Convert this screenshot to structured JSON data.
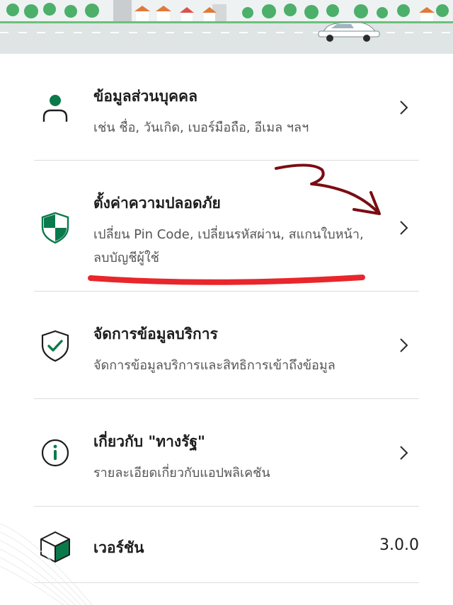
{
  "colors": {
    "brand_green": "#0b7a4b",
    "annotation_red": "#e8262b",
    "annotation_dark": "#7a0d12",
    "divider": "#dcdcdc",
    "banner_bg": "#eef2f2"
  },
  "menu": {
    "items": [
      {
        "icon": "person-icon",
        "title": "ข้อมูลส่วนบุคคล",
        "subtitle": "เช่น ชื่อ, วันเกิด, เบอร์มือถือ, อีเมล ฯลฯ"
      },
      {
        "icon": "shield-icon",
        "title": "ตั้งค่าความปลอดภัย",
        "subtitle": "เปลี่ยน Pin Code, เปลี่ยนรหัสผ่าน, สแกนใบหน้า, ลบบัญชีผู้ใช้"
      },
      {
        "icon": "shield-check-icon",
        "title": "จัดการข้อมูลบริการ",
        "subtitle": "จัดการข้อมูลบริการและสิทธิการเข้าถึงข้อมูล"
      },
      {
        "icon": "info-icon",
        "title": "เกี่ยวกับ \"ทางรัฐ\"",
        "subtitle": "รายละเอียดเกี่ยวกับแอปพลิเคชัน"
      },
      {
        "icon": "cube-icon",
        "title": "เวอร์ชัน",
        "value": "3.0.0"
      }
    ]
  }
}
